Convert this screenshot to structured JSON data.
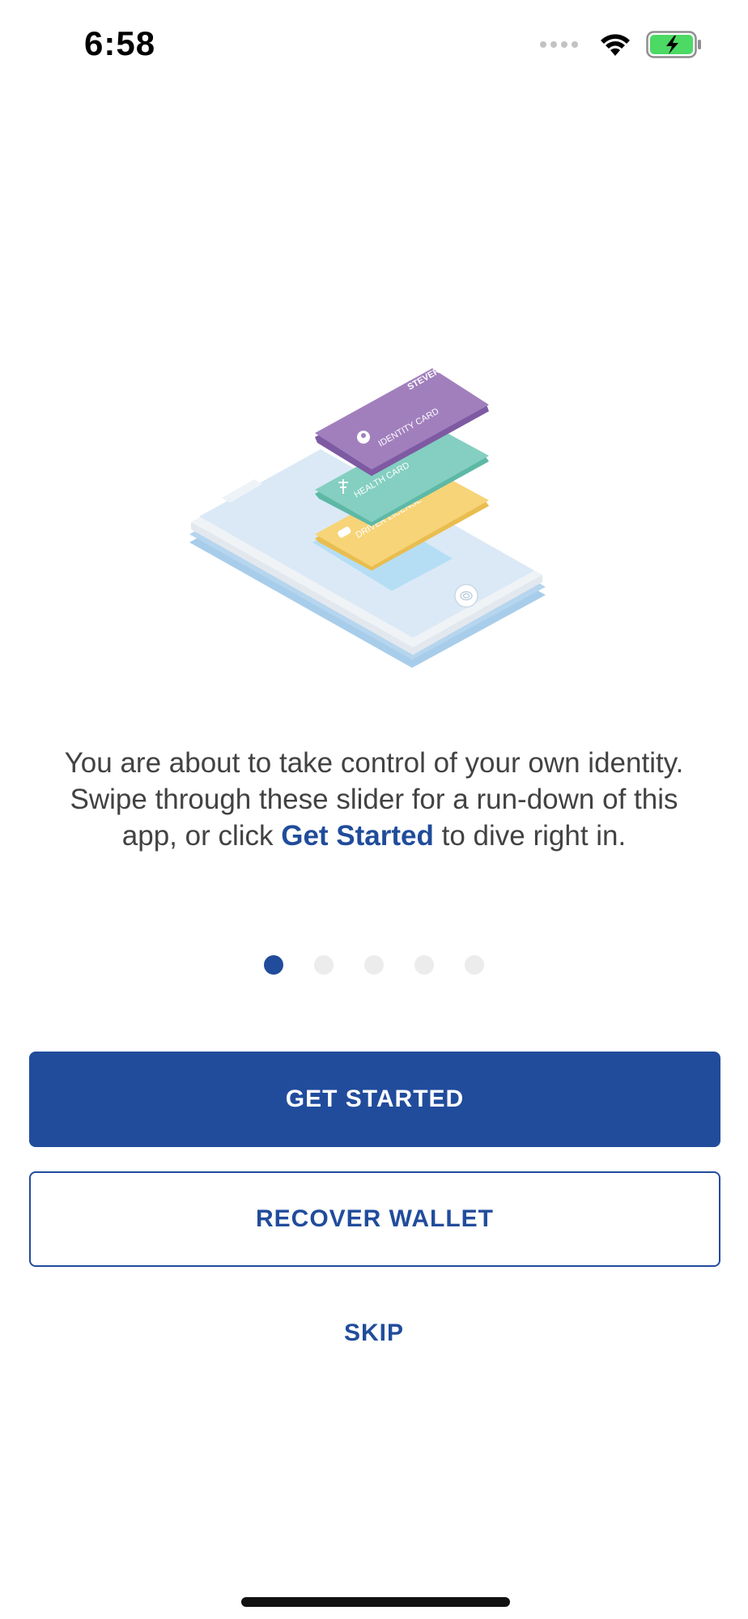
{
  "status_bar": {
    "time": "6:58",
    "icons": [
      "signal-dots-icon",
      "wifi-icon",
      "battery-charging-icon"
    ],
    "battery_color": "#4cd964"
  },
  "illustration": {
    "cards": [
      {
        "name": "identity-card",
        "title": "STEVEROGERS",
        "label": "IDENTITY CARD",
        "color": "#a17fbd"
      },
      {
        "name": "health-card",
        "label": "HEALTH CARD",
        "color": "#84cfc1"
      },
      {
        "name": "driver-license",
        "label": "DRIVER LICENSE",
        "color": "#f7d478"
      }
    ],
    "icons": [
      "person-icon",
      "caduceus-icon",
      "car-icon",
      "fingerprint-icon"
    ]
  },
  "intro": {
    "text_before": "You are about to take control of your own identity. Swipe through these slider for a run-down of this app, or click ",
    "link": "Get Started",
    "text_after": " to dive right in."
  },
  "pager": {
    "total": 5,
    "active_index": 0
  },
  "buttons": {
    "get_started": "GET STARTED",
    "recover_wallet": "RECOVER WALLET",
    "skip": "SKIP"
  },
  "colors": {
    "primary": "#214c9c",
    "pager_inactive": "#ececec"
  }
}
